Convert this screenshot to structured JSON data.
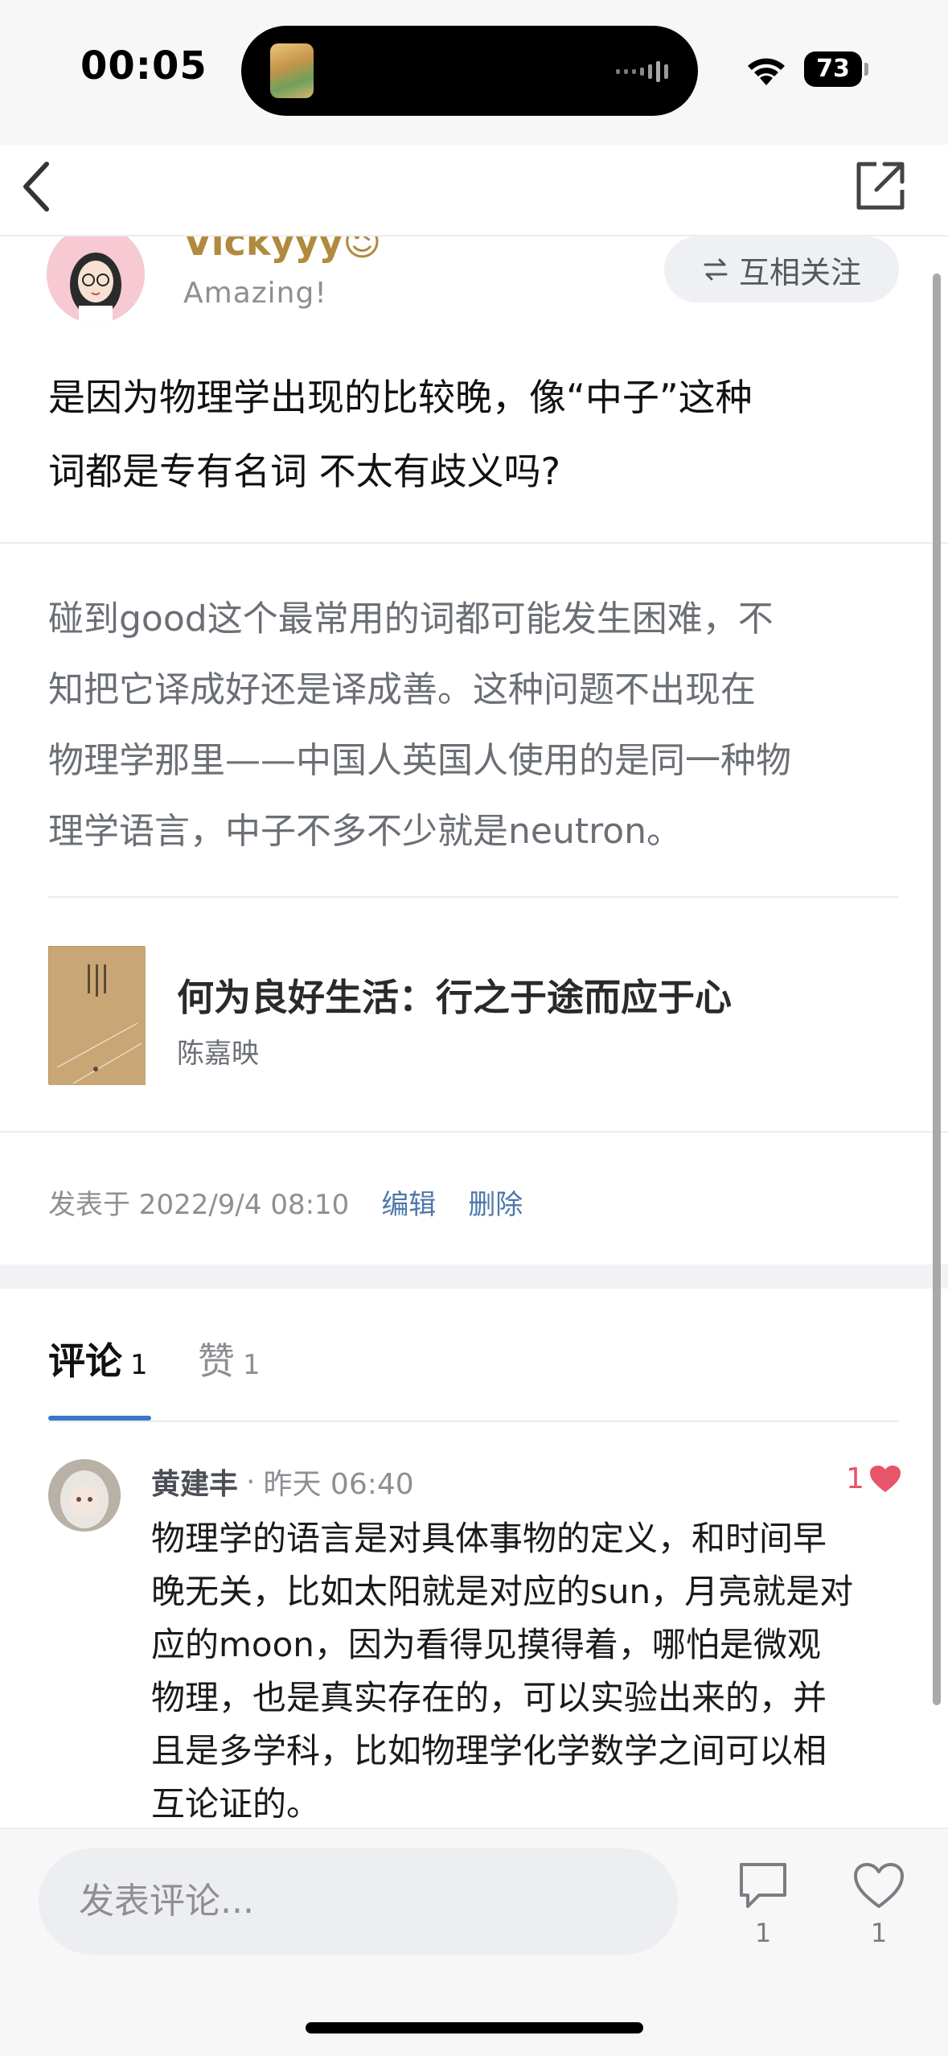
{
  "status_bar": {
    "time": "00:05",
    "battery": "73"
  },
  "author": {
    "name": "Vickyyy😉",
    "signature": "Amazing!",
    "follow_label": "互相关注"
  },
  "post": {
    "question_lines": [
      "是因为物理学出现的比较晚，像“中子”这种",
      "词都是专有名词 不太有歧义吗?"
    ],
    "quote_lines": [
      "碰到good这个最常用的词都可能发生困难，不",
      "知把它译成好还是译成善。这种问题不出现在",
      "物理学那里——中国人英国人使用的是同一种物",
      "理学语言，中子不多不少就是neutron。"
    ],
    "book_title": "何为良好生活：行之于途而应于心",
    "book_author": "陈嘉映",
    "published": "发表于 2022/9/4 08:10",
    "edit_label": "编辑",
    "delete_label": "删除"
  },
  "tabs": {
    "comments_label": "评论",
    "comments_count": "1",
    "likes_label": "赞",
    "likes_count": "1"
  },
  "comment": {
    "user": "黄建丰",
    "separator": "·",
    "time": "昨天 06:40",
    "likes": "1",
    "text_lines": [
      "物理学的语言是对具体事物的定义，和时间早",
      "晚无关，比如太阳就是对应的sun，月亮就是对",
      "应的moon，因为看得见摸得着，哪怕是微观",
      "物理，也是真实存在的，可以实验出来的，并",
      "且是多学科，比如物理学化学数学之间可以相",
      "互论证的。"
    ]
  },
  "bottom_bar": {
    "input_placeholder": "发表评论...",
    "comment_count": "1",
    "like_count": "1"
  },
  "colors": {
    "accent_blue": "#3a78c8",
    "link_blue": "#4d78a8",
    "heart_red": "#e8546a",
    "author_gold": "#b08a3e"
  }
}
